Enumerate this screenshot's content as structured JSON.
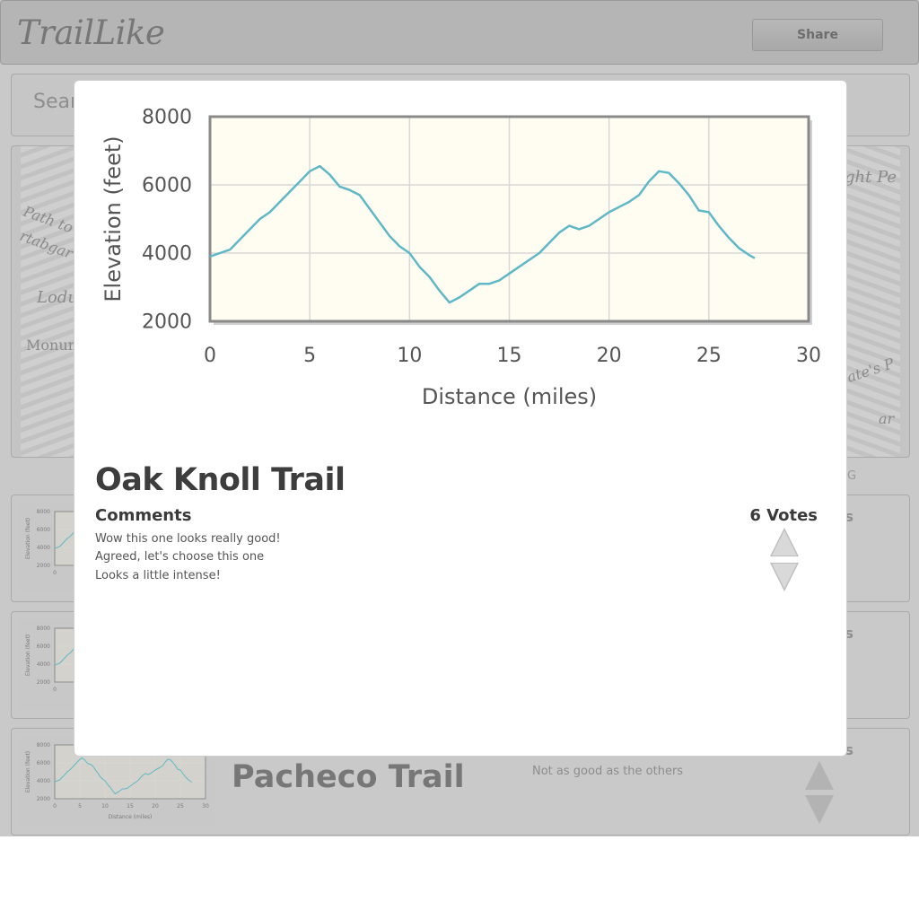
{
  "app": {
    "title": "TrailLike",
    "share_label": "Share"
  },
  "search": {
    "placeholder": "Sear"
  },
  "background": {
    "map_labels": [
      "Path to",
      "rtabgar",
      "Lodu",
      "Monum",
      "ght Pe",
      "ate's P",
      "ar"
    ],
    "g_hint": "G",
    "rows": [
      {
        "title": "",
        "comment": "",
        "votes_hint": "s"
      },
      {
        "title": "",
        "comment": "",
        "votes_hint": "s"
      },
      {
        "title": "Pacheco Trail",
        "comment": "Not as good as the others",
        "votes_hint": "s"
      }
    ],
    "mini_chart": {
      "ylabel": "Elevation (feet)",
      "xlabel": "Distance (miles)",
      "yticks": [
        "8000",
        "6000",
        "4000",
        "2000"
      ],
      "xticks": [
        "0",
        "5",
        "10",
        "15",
        "20",
        "25",
        "30"
      ]
    }
  },
  "modal": {
    "trail_name": "Oak Knoll Trail",
    "comments_heading": "Comments",
    "comments": [
      "Wow this one looks really good!",
      "Agreed, let's choose this one",
      "Looks a little intense!"
    ],
    "votes_label": "6 Votes"
  },
  "chart_data": {
    "type": "line",
    "title": "",
    "xlabel": "Distance (miles)",
    "ylabel": "Elevation (feet)",
    "xlim": [
      0,
      30
    ],
    "ylim": [
      2000,
      8000
    ],
    "xticks": [
      0,
      5,
      10,
      15,
      20,
      25,
      30
    ],
    "yticks": [
      2000,
      4000,
      6000,
      8000
    ],
    "grid": true,
    "line_color": "#5fb8c6",
    "plot_background": "#fffcf2",
    "x": [
      0,
      1,
      2,
      2.5,
      3,
      4,
      4.5,
      5,
      5.5,
      6,
      6.5,
      7,
      7.5,
      8,
      8.5,
      9,
      9.5,
      10,
      10.5,
      11,
      11.5,
      12,
      12.5,
      13,
      13.5,
      14,
      14.5,
      15,
      15.5,
      16,
      16.5,
      17,
      17.5,
      18,
      18.5,
      19,
      19.5,
      20,
      20.5,
      21,
      21.5,
      22,
      22.5,
      23,
      23.5,
      24,
      24.5,
      25,
      25.5,
      26,
      26.5,
      27,
      27.3
    ],
    "values": [
      3900,
      4100,
      4700,
      5000,
      5200,
      5800,
      6100,
      6400,
      6550,
      6300,
      5950,
      5850,
      5700,
      5300,
      4900,
      4500,
      4200,
      4000,
      3600,
      3300,
      2900,
      2550,
      2700,
      2900,
      3100,
      3100,
      3200,
      3400,
      3600,
      3800,
      4000,
      4300,
      4600,
      4800,
      4700,
      4800,
      5000,
      5200,
      5350,
      5500,
      5700,
      6100,
      6400,
      6350,
      6050,
      5700,
      5250,
      5200,
      4800,
      4450,
      4150,
      3950,
      3850
    ]
  }
}
